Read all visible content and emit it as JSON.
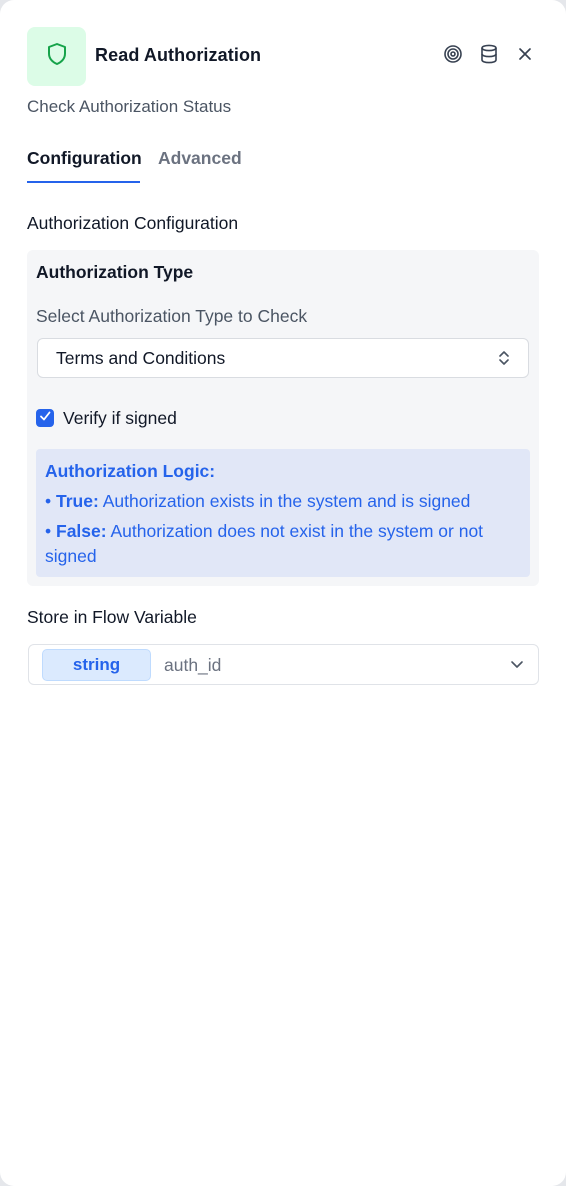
{
  "header": {
    "title": "Read Authorization",
    "subtitle": "Check Authorization Status",
    "icons": [
      "shield-icon",
      "target-icon",
      "database-icon",
      "close-icon"
    ],
    "accent_color": "#16a34a"
  },
  "tabs": [
    {
      "label": "Configuration",
      "active": true
    },
    {
      "label": "Advanced",
      "active": false
    }
  ],
  "config": {
    "section_title": "Authorization Configuration",
    "card_title": "Authorization Type",
    "select_label": "Select Authorization Type to Check",
    "select_value": "Terms and Conditions",
    "verify_checked": true,
    "verify_label": "Verify if signed",
    "logic": {
      "title": "Authorization Logic:",
      "true_key": "True:",
      "true_text": "Authorization exists in the system and is signed",
      "false_key": "False:",
      "false_text": "Authorization does not exist in the system or not signed"
    }
  },
  "store": {
    "label": "Store in Flow Variable",
    "type": "string",
    "variable": "auth_id"
  },
  "colors": {
    "primary": "#2563eb",
    "success_bg": "#dcfce7",
    "logic_bg": "#e1e7f7"
  }
}
